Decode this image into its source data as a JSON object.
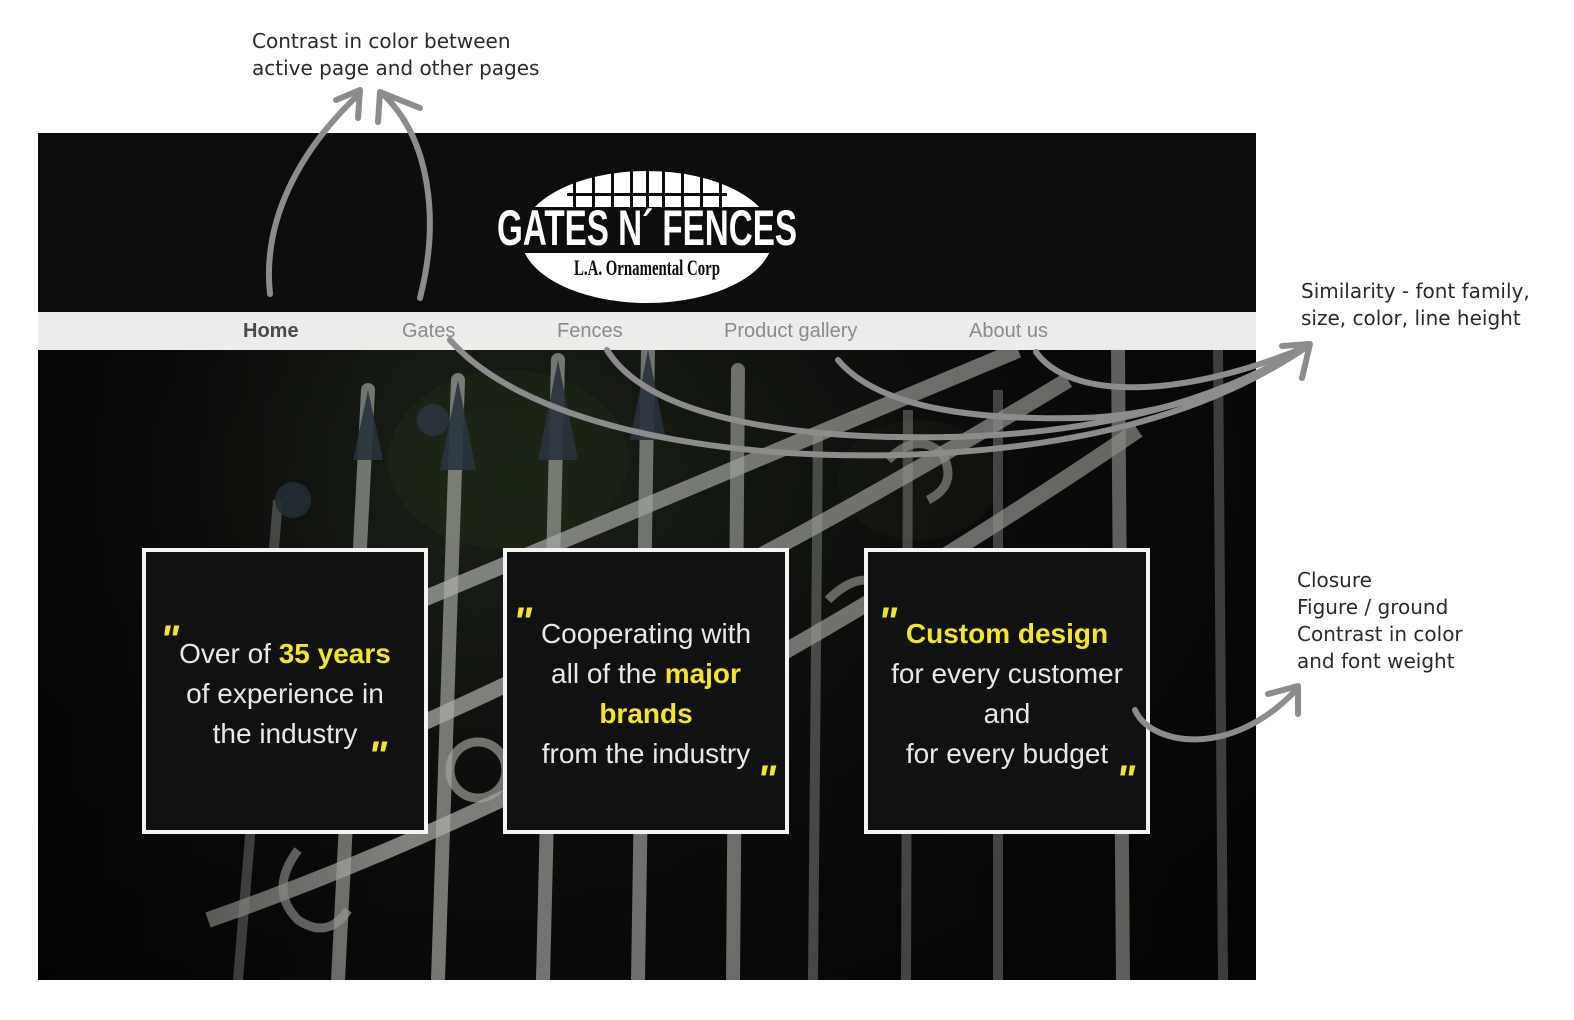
{
  "annotations": {
    "active_contrast": [
      "Contrast in color between",
      "active page and other pages"
    ],
    "similarity": [
      "Similarity - font family,",
      "size, color, line height"
    ],
    "closure": [
      "Closure",
      "Figure / ground",
      "Contrast in color",
      "and font weight"
    ]
  },
  "logo": {
    "title": "GATES N´ FENCES",
    "subtitle": "L.A. Ornamental Corp"
  },
  "nav": {
    "items": [
      "Home",
      "Gates",
      "Fences",
      "Product gallery",
      "About us"
    ],
    "active": "Home"
  },
  "cards": [
    {
      "lines": [
        {
          "pre": "Over of ",
          "hl": "35 years",
          "post": ""
        },
        {
          "pre": "of experience in",
          "hl": "",
          "post": ""
        },
        {
          "pre": "the industry",
          "hl": "",
          "post": ""
        }
      ]
    },
    {
      "lines": [
        {
          "pre": "Cooperating with",
          "hl": "",
          "post": ""
        },
        {
          "pre": "all of the ",
          "hl": "major",
          "post": ""
        },
        {
          "pre": "",
          "hl": "brands",
          "post": ""
        },
        {
          "pre": "from the industry",
          "hl": "",
          "post": ""
        }
      ]
    },
    {
      "lines": [
        {
          "pre": "",
          "hl": "Custom design",
          "post": ""
        },
        {
          "pre": "for every customer",
          "hl": "",
          "post": ""
        },
        {
          "pre": "and",
          "hl": "",
          "post": ""
        },
        {
          "pre": "for every budget",
          "hl": "",
          "post": ""
        }
      ]
    }
  ],
  "quote_mark": "\"",
  "colors": {
    "accent_yellow": "#f2e62a",
    "header_black": "#0d0d0d",
    "nav_bg": "#ececea",
    "arrow_gray": "#8c8c8c"
  }
}
